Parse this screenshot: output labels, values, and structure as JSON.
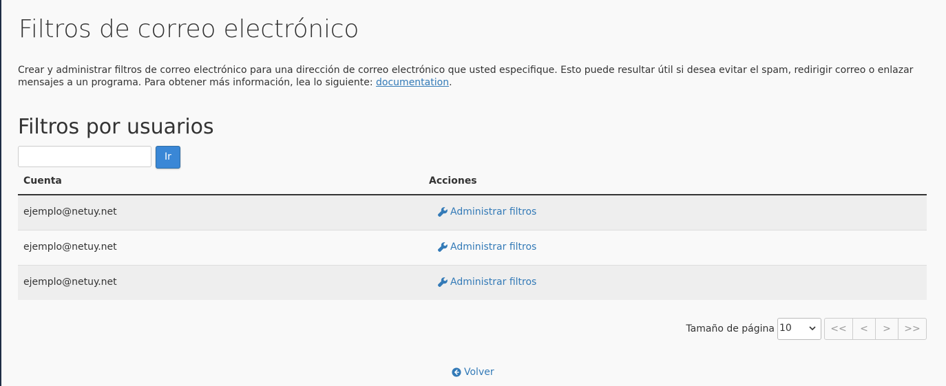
{
  "page": {
    "title": "Filtros de correo electrónico",
    "description_text": "Crear y administrar filtros de correo electrónico para una dirección de correo electrónico que usted especifique. Esto puede resultar útil si desea evitar el spam, redirigir correo o enlazar mensajes a un programa. Para obtener más información, lea lo siguiente: ",
    "description_link": "documentation",
    "description_end": "."
  },
  "section": {
    "title": "Filtros por usuarios",
    "search_value": "",
    "go_button": "Ir"
  },
  "table": {
    "headers": [
      "Cuenta",
      "Acciones"
    ],
    "rows": [
      {
        "account": "ejemplo@netuy.net",
        "action": "Administrar filtros"
      },
      {
        "account": "ejemplo@netuy.net",
        "action": "Administrar filtros"
      },
      {
        "account": "ejemplo@netuy.net",
        "action": "Administrar filtros"
      }
    ],
    "action_icon": "wrench-icon"
  },
  "pagination": {
    "label": "Tamaño de página",
    "page_size": "10",
    "first": "<<",
    "prev": "<",
    "next": ">",
    "last": ">>"
  },
  "footer": {
    "back_label": "Volver",
    "back_icon": "arrow-circle-left-icon"
  },
  "colors": {
    "link": "#337ab7",
    "primary_button": "#3a87d6",
    "row_stripe": "#eeeeee",
    "background": "#f9f9f9"
  }
}
